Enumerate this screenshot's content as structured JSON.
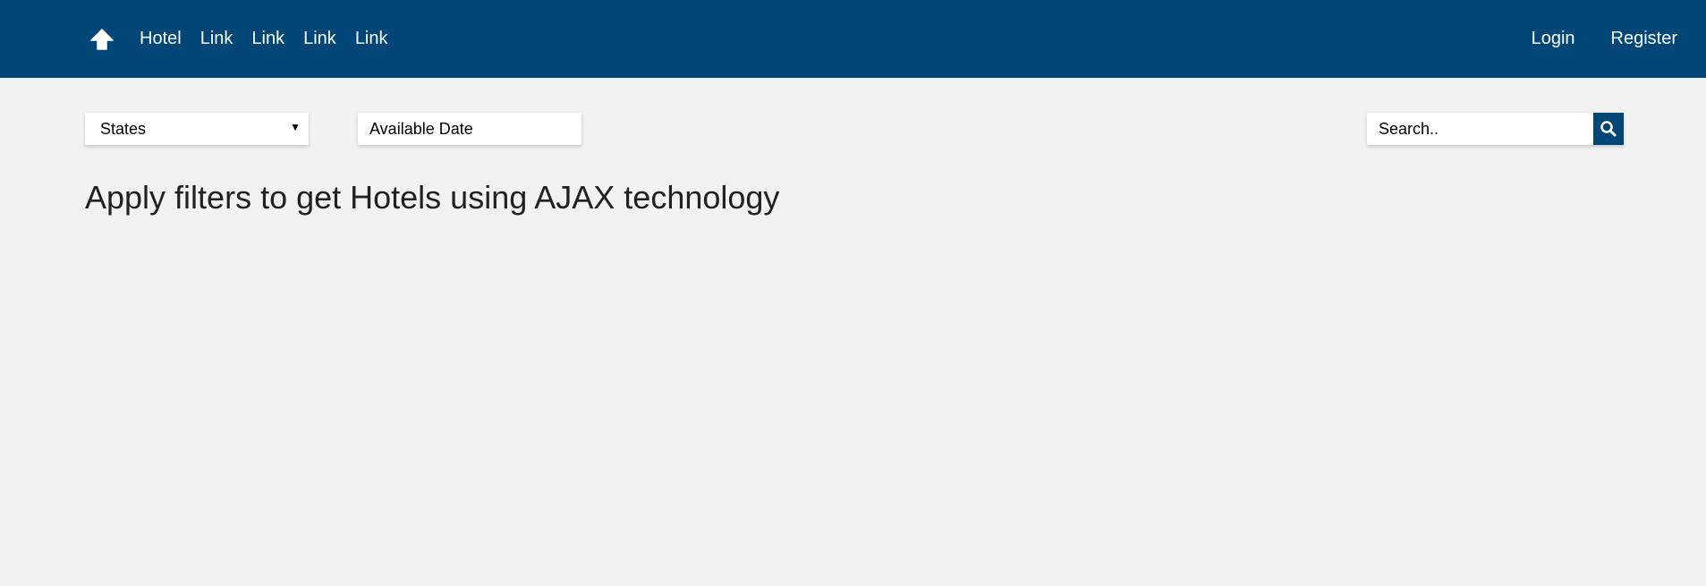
{
  "navbar": {
    "home_icon": "arrow-up-icon",
    "links": [
      "Hotel",
      "Link",
      "Link",
      "Link",
      "Link"
    ],
    "login_label": "Login",
    "register_label": "Register",
    "background_color": "#004677"
  },
  "filters": {
    "states_selected": "States",
    "date_placeholder": "Available Date",
    "search_placeholder": "Search..",
    "search_icon": "search-icon"
  },
  "main": {
    "heading": "Apply filters to get Hotels using AJAX technology"
  }
}
